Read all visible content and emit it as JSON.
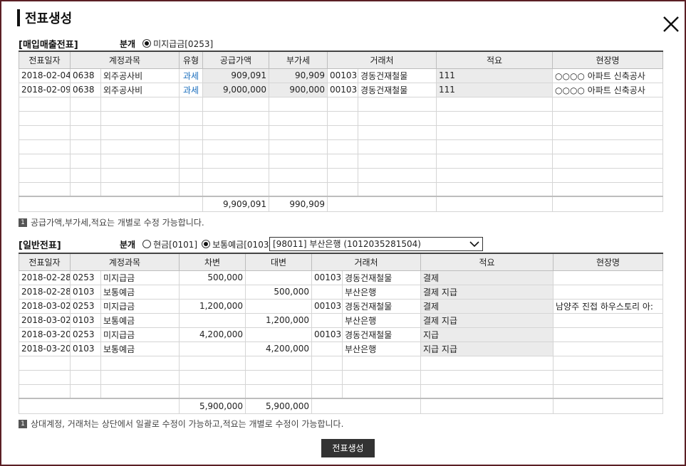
{
  "title": "전표생성",
  "purchase": {
    "section_title": "[매입매출전표]",
    "bungae_label": "분개",
    "radio_label": "미지급금[0253]",
    "columns": [
      "전표일자",
      "계정과목",
      "유형",
      "공급가액",
      "부가세",
      "거래처",
      "적요",
      "현장명"
    ],
    "rows": [
      {
        "date": "2018-02-04",
        "acct_code": "0638",
        "acct_name": "외주공사비",
        "type": "과세",
        "supply": "909,091",
        "vat": "90,909",
        "vendor_code": "00103",
        "vendor_name": "경동건재철물",
        "memo": "111",
        "site": "○○○○ 아파트 신축공사"
      },
      {
        "date": "2018-02-09",
        "acct_code": "0638",
        "acct_name": "외주공사비",
        "type": "과세",
        "supply": "9,000,000",
        "vat": "900,000",
        "vendor_code": "00103",
        "vendor_name": "경동건재철물",
        "memo": "111",
        "site": "○○○○ 아파트 신축공사"
      }
    ],
    "total_supply": "9,909,091",
    "total_vat": "990,909",
    "note": "공급가액,부가세,적요는 개별로 수정 가능합니다.",
    "note_badge": "1"
  },
  "general": {
    "section_title": "[일반전표]",
    "bungae_label": "분개",
    "radio_cash": "현금[0101]",
    "radio_deposit": "보통예금[0103]",
    "bank_select": "[98011] 부산은행 (1012035281504)",
    "columns": [
      "전표일자",
      "계정과목",
      "차변",
      "대변",
      "거래처",
      "적요",
      "현장명"
    ],
    "rows": [
      {
        "date": "2018-02-28",
        "acct_code": "0253",
        "acct_name": "미지급금",
        "debit": "500,000",
        "credit": "",
        "vendor_code": "00103",
        "vendor_name": "경동건재철물",
        "memo": "결제",
        "site": ""
      },
      {
        "date": "2018-02-28",
        "acct_code": "0103",
        "acct_name": "보통예금",
        "debit": "",
        "credit": "500,000",
        "vendor_code": "",
        "vendor_name": "부산은행",
        "memo": "결제 지급",
        "site": ""
      },
      {
        "date": "2018-03-02",
        "acct_code": "0253",
        "acct_name": "미지급금",
        "debit": "1,200,000",
        "credit": "",
        "vendor_code": "00103",
        "vendor_name": "경동건재철물",
        "memo": "결제",
        "site": "남양주 진접 하우스토리 아:"
      },
      {
        "date": "2018-03-02",
        "acct_code": "0103",
        "acct_name": "보통예금",
        "debit": "",
        "credit": "1,200,000",
        "vendor_code": "",
        "vendor_name": "부산은행",
        "memo": "결제 지급",
        "site": ""
      },
      {
        "date": "2018-03-20",
        "acct_code": "0253",
        "acct_name": "미지급금",
        "debit": "4,200,000",
        "credit": "",
        "vendor_code": "00103",
        "vendor_name": "경동건재철물",
        "memo": "지급",
        "site": ""
      },
      {
        "date": "2018-03-20",
        "acct_code": "0103",
        "acct_name": "보통예금",
        "debit": "",
        "credit": "4,200,000",
        "vendor_code": "",
        "vendor_name": "부산은행",
        "memo": "지급 지급",
        "site": ""
      }
    ],
    "total_debit": "5,900,000",
    "total_credit": "5,900,000",
    "note": "상대계정, 거래처는 상단에서 일괄로 수정이 가능하고,적요는 개별로 수정이 가능합니다.",
    "note_badge": "1"
  },
  "create_button": "전표생성",
  "icons": {
    "close": "close-icon",
    "select": "chevron-down-icon"
  }
}
